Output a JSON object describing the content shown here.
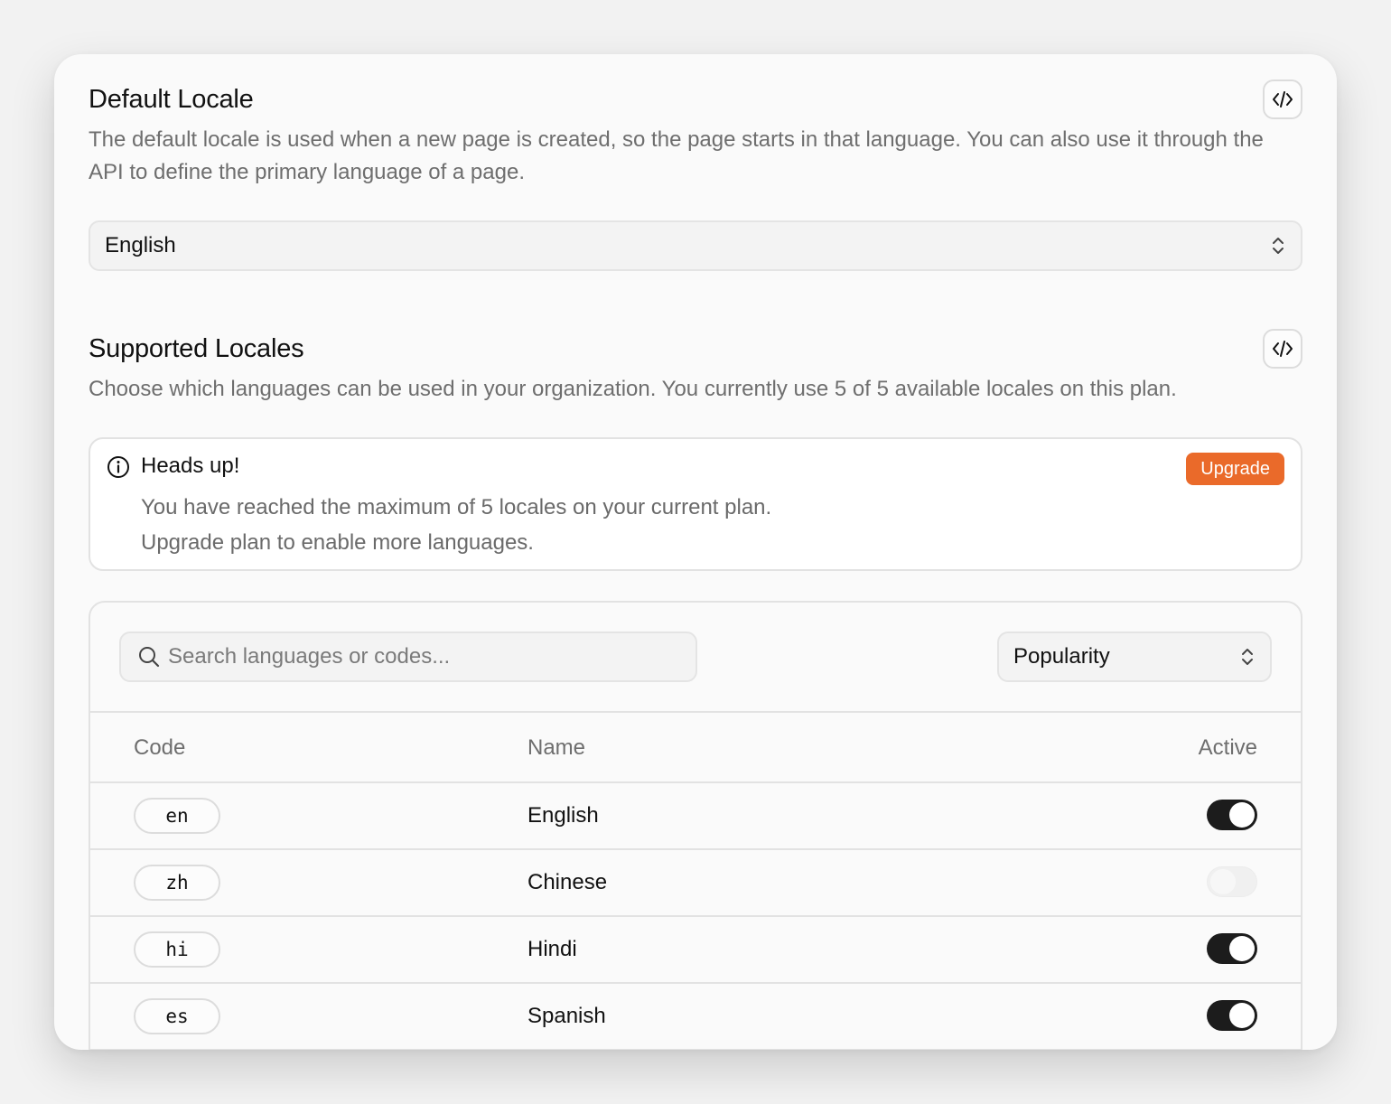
{
  "default_locale": {
    "title": "Default Locale",
    "description": "The default locale is used when a new page is created, so the page starts in that language. You can also use it through the API to define the primary language of a page.",
    "selected": "English",
    "code_button_icon": "code-icon"
  },
  "supported_locales": {
    "title": "Supported Locales",
    "description": "Choose which languages can be used in your organization. You currently use 5 of 5 available locales on this plan.",
    "code_button_icon": "code-icon"
  },
  "alert": {
    "icon": "info-icon",
    "title": "Heads up!",
    "line1": "You have reached the maximum of 5 locales on your current plan.",
    "line2": "Upgrade plan to enable more languages.",
    "button_label": "Upgrade",
    "button_color": "#ea6a2a"
  },
  "table": {
    "search_placeholder": "Search languages or codes...",
    "search_value": "",
    "sort_selected": "Popularity",
    "columns": {
      "code": "Code",
      "name": "Name",
      "active": "Active"
    },
    "rows": [
      {
        "code": "en",
        "name": "English",
        "active": true
      },
      {
        "code": "zh",
        "name": "Chinese",
        "active": false
      },
      {
        "code": "hi",
        "name": "Hindi",
        "active": true
      },
      {
        "code": "es",
        "name": "Spanish",
        "active": true
      }
    ]
  },
  "colors": {
    "accent": "#ea6a2a",
    "toggle_on": "#1c1c1c"
  }
}
